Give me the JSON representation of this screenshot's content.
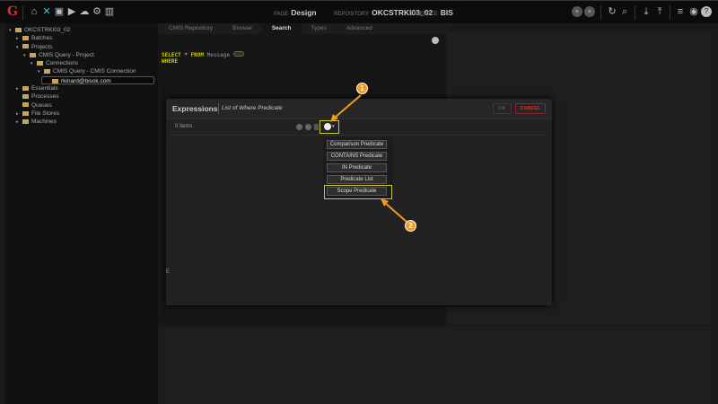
{
  "header": {
    "page_label": "PAGE",
    "page": "Design",
    "repository_label": "REPOSITORY",
    "repository": "OKCSTRKI03_02",
    "licensee_label": "LICENSEE",
    "licensee": "BIS"
  },
  "tree": [
    {
      "label": "OKCSTRKI03_02",
      "indent": 0,
      "arrow": "▾"
    },
    {
      "label": "Batches",
      "indent": 1,
      "arrow": "▸"
    },
    {
      "label": "Projects",
      "indent": 1,
      "arrow": "▾"
    },
    {
      "label": "CMIS Query - Project",
      "indent": 2,
      "arrow": "▾"
    },
    {
      "label": "Connections",
      "indent": 3,
      "arrow": "▾"
    },
    {
      "label": "CMIS Query - CMIS Connection",
      "indent": 4,
      "arrow": "▾"
    },
    {
      "label": "rkinard@bisok.com",
      "indent": 5,
      "arrow": ""
    },
    {
      "label": "Essentials",
      "indent": 1,
      "arrow": "▸"
    },
    {
      "label": "Processes",
      "indent": 1,
      "arrow": ""
    },
    {
      "label": "Queues",
      "indent": 1,
      "arrow": ""
    },
    {
      "label": "File Stores",
      "indent": 1,
      "arrow": "▸"
    },
    {
      "label": "Machines",
      "indent": 1,
      "arrow": "▸"
    }
  ],
  "tabs": [
    "CMIS Repository",
    "Browse",
    "Search",
    "Types",
    "Advanced"
  ],
  "query": {
    "select": "SELECT",
    "star": "*",
    "from": "FROM",
    "table": "Message",
    "where": "WHERE"
  },
  "modal": {
    "title": "Expressions",
    "subtitle": "List of Where Predicate",
    "ok": "OK",
    "cancel": "CANCEL",
    "count": "0 items"
  },
  "menu": [
    "Comparison Predicate",
    "CONTAINS Predicate",
    "IN Predicate",
    "Predicate List",
    "Scope Predicate"
  ],
  "callouts": [
    "1",
    "2"
  ]
}
